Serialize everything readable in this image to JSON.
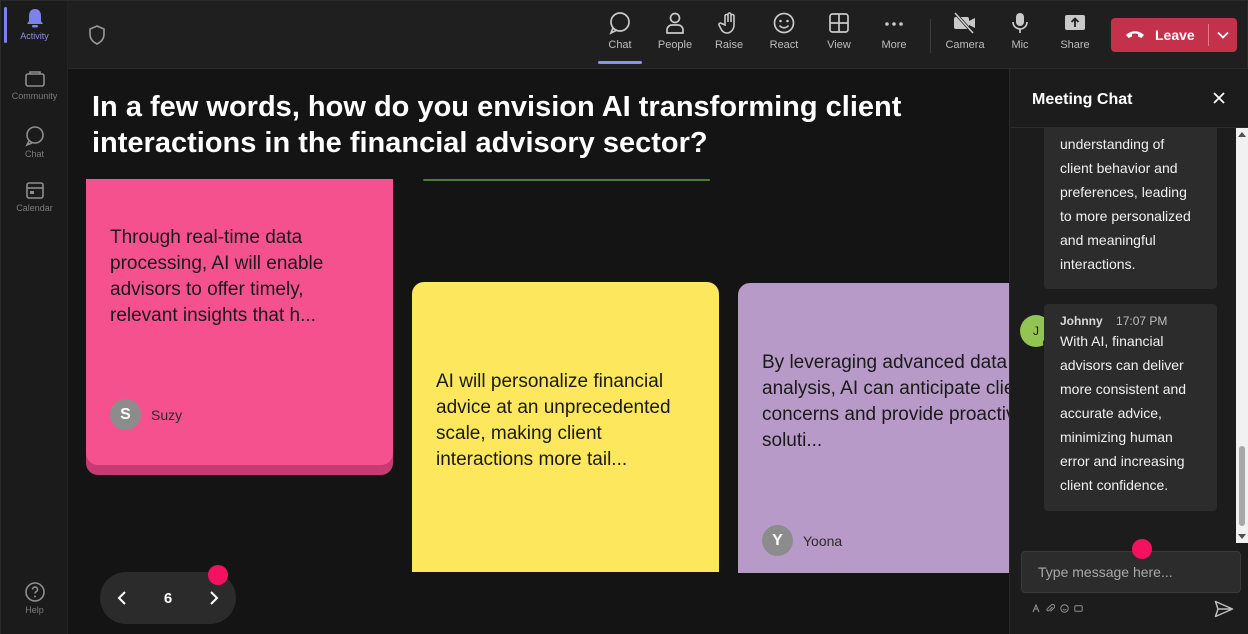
{
  "rail": {
    "items": [
      {
        "label": "Activity",
        "icon": "bell-icon"
      },
      {
        "label": "Community",
        "icon": "community-icon"
      },
      {
        "label": "Chat",
        "icon": "chat-icon"
      },
      {
        "label": "Calendar",
        "icon": "calendar-icon"
      }
    ],
    "help_label": "Help"
  },
  "toolbar": {
    "items": [
      {
        "label": "Chat",
        "icon": "chat-icon"
      },
      {
        "label": "People",
        "icon": "people-icon"
      },
      {
        "label": "Raise",
        "icon": "raise-hand-icon"
      },
      {
        "label": "React",
        "icon": "react-smiley-icon"
      },
      {
        "label": "View",
        "icon": "view-grid-icon"
      },
      {
        "label": "More",
        "icon": "more-icon"
      },
      {
        "label": "Camera",
        "icon": "camera-off-icon"
      },
      {
        "label": "Mic",
        "icon": "mic-icon"
      },
      {
        "label": "Share",
        "icon": "share-icon"
      }
    ],
    "leave_label": "Leave"
  },
  "stage": {
    "question": "In a few words, how do you envision AI transforming client interactions in the financial advisory sector?",
    "cards": [
      {
        "text": "Through real-time data processing, AI will enable advisors to offer timely, relevant insights that h...",
        "author": "Suzy",
        "initial": "S"
      },
      {
        "text": "AI will personalize financial advice at an unprecedented scale, making client interactions more tail...",
        "author": "",
        "initial": ""
      },
      {
        "text": "By leveraging advanced data analysis, AI can anticipate client concerns and provide proactive soluti...",
        "author": "Yoona",
        "initial": "Y"
      }
    ],
    "pager": {
      "page": "6"
    }
  },
  "chat": {
    "title": "Meeting Chat",
    "messages": [
      {
        "lines": [
          "understanding of",
          "client behavior and",
          "preferences, leading",
          "to more personalized",
          "and meaningful",
          "interactions."
        ]
      },
      {
        "sender": "Johnny",
        "time": "17:07 PM",
        "initial": "J",
        "lines": [
          "With AI, financial",
          "advisors can deliver",
          "more consistent and",
          "accurate advice,",
          "minimizing human",
          "error and increasing",
          "client confidence."
        ]
      }
    ],
    "input_placeholder": "Type message here..."
  },
  "colors": {
    "accent": "#7b83eb",
    "leave": "#c4314b",
    "pink_card": "#f6518f",
    "yellow_card": "#fde75c",
    "purple_card": "#b89ac8",
    "marker": "#f4115f"
  }
}
